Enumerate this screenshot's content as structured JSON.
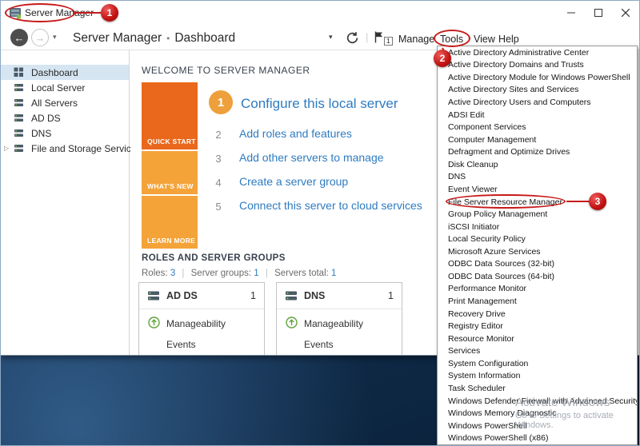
{
  "titlebar": {
    "title": "Server Manager"
  },
  "navbar": {
    "breadcrumb": {
      "root": "Server Manager",
      "separator": "•",
      "current": "Dashboard"
    },
    "notification_count": "1",
    "menus": [
      "Manage",
      "Tools",
      "View",
      "Help"
    ]
  },
  "sidebar": {
    "items": [
      {
        "label": "Dashboard",
        "selected": true
      },
      {
        "label": "Local Server"
      },
      {
        "label": "All Servers"
      },
      {
        "label": "AD DS"
      },
      {
        "label": "DNS"
      },
      {
        "label": "File and Storage Services",
        "expandable": true
      }
    ]
  },
  "main": {
    "welcome_title": "WELCOME TO SERVER MANAGER",
    "tiles": [
      "QUICK START",
      "WHAT'S NEW",
      "LEARN MORE"
    ],
    "steps": [
      {
        "num": "1",
        "label": "Configure this local server"
      },
      {
        "num": "2",
        "label": "Add roles and features"
      },
      {
        "num": "3",
        "label": "Add other servers to manage"
      },
      {
        "num": "4",
        "label": "Create a server group"
      },
      {
        "num": "5",
        "label": "Connect this server to cloud services"
      }
    ],
    "roles_title": "ROLES AND SERVER GROUPS",
    "summary": {
      "roles_label": "Roles:",
      "roles_value": "3",
      "sep": "|",
      "groups_label": "Server groups:",
      "groups_value": "1",
      "servers_label": "Servers total:",
      "servers_value": "1"
    },
    "cards": [
      {
        "name": "AD DS",
        "count": "1",
        "rows": [
          "Manageability",
          "Events"
        ]
      },
      {
        "name": "DNS",
        "count": "1",
        "rows": [
          "Manageability",
          "Events"
        ]
      }
    ]
  },
  "tools_menu": {
    "items": [
      {
        "label": "Active Directory Administrative Center"
      },
      {
        "label": "Active Directory Domains and Trusts"
      },
      {
        "label": "Active Directory Module for Windows PowerShell"
      },
      {
        "label": "Active Directory Sites and Services"
      },
      {
        "label": "Active Directory Users and Computers"
      },
      {
        "label": "ADSI Edit"
      },
      {
        "label": "Component Services"
      },
      {
        "label": "Computer Management"
      },
      {
        "label": "Defragment and Optimize Drives"
      },
      {
        "label": "Disk Cleanup"
      },
      {
        "label": "DNS"
      },
      {
        "label": "Event Viewer"
      },
      {
        "label": "File Server Resource Manager"
      },
      {
        "label": "Group Policy Management"
      },
      {
        "label": "iSCSI Initiator"
      },
      {
        "label": "Local Security Policy"
      },
      {
        "label": "Microsoft Azure Services"
      },
      {
        "label": "ODBC Data Sources (32-bit)"
      },
      {
        "label": "ODBC Data Sources (64-bit)"
      },
      {
        "label": "Performance Monitor"
      },
      {
        "label": "Print Management"
      },
      {
        "label": "Recovery Drive"
      },
      {
        "label": "Registry Editor"
      },
      {
        "label": "Resource Monitor"
      },
      {
        "label": "Services"
      },
      {
        "label": "System Configuration"
      },
      {
        "label": "System Information"
      },
      {
        "label": "Task Scheduler"
      },
      {
        "label": "Windows Defender Firewall with Advanced Security"
      },
      {
        "label": "Windows Memory Diagnostic"
      },
      {
        "label": "Windows PowerShell"
      },
      {
        "label": "Windows PowerShell (x86)"
      }
    ]
  },
  "annotations": {
    "n1": "1",
    "n2": "2",
    "n3": "3"
  },
  "watermark": {
    "line1": "Activate Windows",
    "line2": "Go to Settings to activate Windows."
  },
  "colors": {
    "accent_blue": "#2e7bc1",
    "tile_orange_dark": "#e9681c",
    "tile_orange_light": "#f4a339",
    "annotation_red": "#c61a1a",
    "manageability_green": "#5fa33c",
    "desktop_blue": "#123052"
  }
}
